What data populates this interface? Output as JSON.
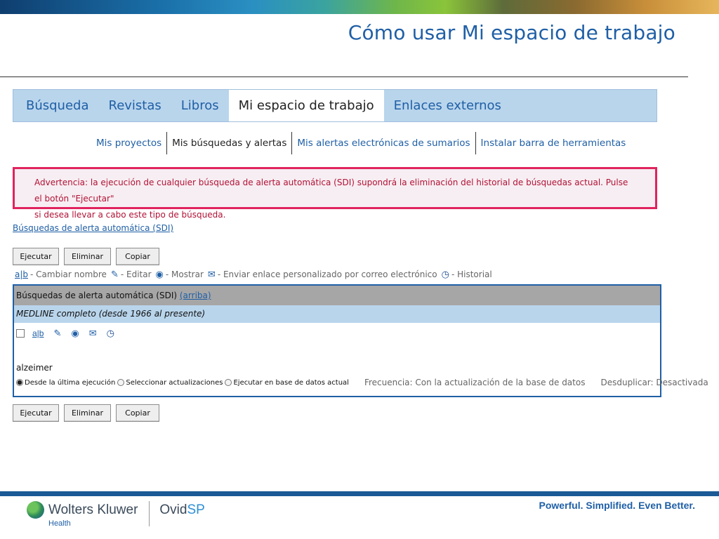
{
  "slide": {
    "title": "Cómo usar Mi espacio de trabajo"
  },
  "tabs": [
    {
      "label": "Búsqueda"
    },
    {
      "label": "Revistas"
    },
    {
      "label": "Libros"
    },
    {
      "label": "Mi espacio de trabajo",
      "active": true
    },
    {
      "label": "Enlaces externos"
    }
  ],
  "subnav": [
    {
      "label": "Mis proyectos"
    },
    {
      "label": "Mis búsquedas y alertas",
      "active": true
    },
    {
      "label": "Mis alertas electrónicas de sumarios"
    },
    {
      "label": "Instalar barra de herramientas"
    }
  ],
  "warning": {
    "line1": "Advertencia: la ejecución de cualquier búsqueda de alerta automática (SDI) supondrá la eliminación del historial de búsquedas actual. Pulse el botón \"Ejecutar\"",
    "line2": "si desea llevar a cabo este tipo de búsqueda."
  },
  "sdi_link": "Búsquedas de alerta automática (SDI)",
  "buttons": {
    "run": "Ejecutar",
    "delete": "Eliminar",
    "copy": "Copiar"
  },
  "legend": {
    "rename": "- Cambiar nombre",
    "edit": "- Editar",
    "show": "- Mostrar",
    "email": "- Enviar enlace personalizado por correo electrónico",
    "history": "- Historial"
  },
  "panel": {
    "heading": "Búsquedas de alerta automática (SDI)",
    "top_link": "(arriba)",
    "database": "MEDLINE completo (desde 1966 al presente)",
    "search_name": "alzeimer",
    "options": [
      {
        "label": "Desde la última ejecución",
        "selected": true
      },
      {
        "label": "Seleccionar actualizaciones",
        "selected": false
      },
      {
        "label": "Ejecutar en base de datos actual",
        "selected": false
      }
    ],
    "frequency": "Frecuencia: Con la actualización de la base de datos",
    "dedupe": "Desduplicar: Desactivada"
  },
  "footer": {
    "company": "Wolters Kluwer",
    "division": "Health",
    "product_a": "Ovid",
    "product_b": "SP",
    "tagline": "Powerful. Simplified. Even Better."
  },
  "colors": {
    "accent": "#1f5fa6",
    "warning": "#e0245e",
    "tab_bg": "#b9d5ec"
  },
  "icons": [
    "rename-icon",
    "edit-pencil-icon",
    "show-eye-icon",
    "email-icon",
    "history-clock-icon",
    "globe-logo-icon"
  ]
}
